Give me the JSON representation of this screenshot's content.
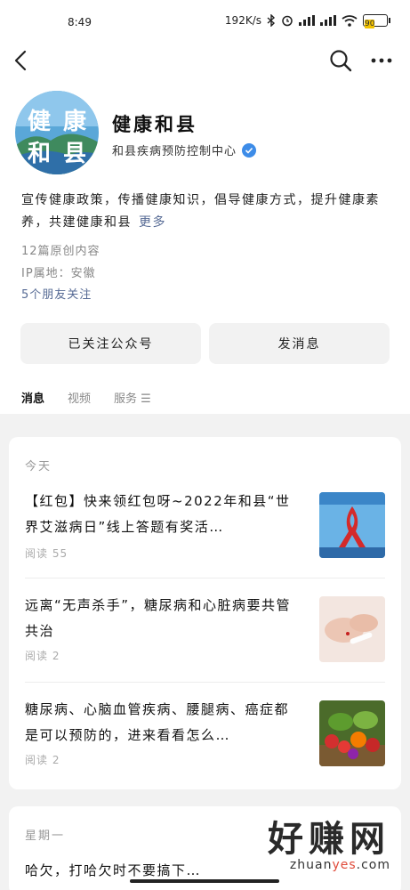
{
  "status_bar": {
    "time": "8:49",
    "net_speed": "192K/s",
    "battery": "90"
  },
  "nav": {
    "back_icon": "chevron-left-icon",
    "search_icon": "search-icon",
    "more_icon": "more-icon"
  },
  "profile": {
    "avatar_line1": "健康",
    "avatar_line2": "和县",
    "name": "健康和县",
    "org": "和县疾病预防控制中心",
    "desc_line1": "宣传健康政策，传播健康知识，倡导健康方式，提升健康素",
    "desc_line2": "养，共建健康和县",
    "more": "更多",
    "articles_count": "12篇原创内容",
    "ip_location": "IP属地：安徽",
    "friends": "5个朋友关注"
  },
  "actions": {
    "followed": "已关注公众号",
    "message": "发消息"
  },
  "tabs": [
    {
      "label": "消息",
      "active": true
    },
    {
      "label": "视频",
      "active": false
    },
    {
      "label": "服务 ☰",
      "active": false
    }
  ],
  "feed": {
    "today": "今天",
    "articles": [
      {
        "title": "【红包】快来领红包呀~2022年和县“世界艾滋病日”线上答题有奖活…",
        "reads": "阅读 55",
        "thumb": "red-ribbon-image"
      },
      {
        "title": "远离“无声杀手”，糖尿病和心脏病要共管共治",
        "reads": "阅读 2",
        "thumb": "blood-test-image"
      },
      {
        "title": "糖尿病、心脑血管疾病、腰腿病、癌症都是可以预防的，进来看看怎么…",
        "reads": "阅读 2",
        "thumb": "vegetables-image"
      }
    ],
    "monday": "星期一",
    "monday_preview": "哈欠，打哈欠时不要搞下…"
  },
  "watermark": {
    "big": "好赚网",
    "url_prefix": "zhuan",
    "url_hl": "yes",
    "url_suffix": ".com"
  },
  "colors": {
    "link": "#576b95",
    "verified": "#3d8ce8",
    "battery": "#f2c300"
  }
}
